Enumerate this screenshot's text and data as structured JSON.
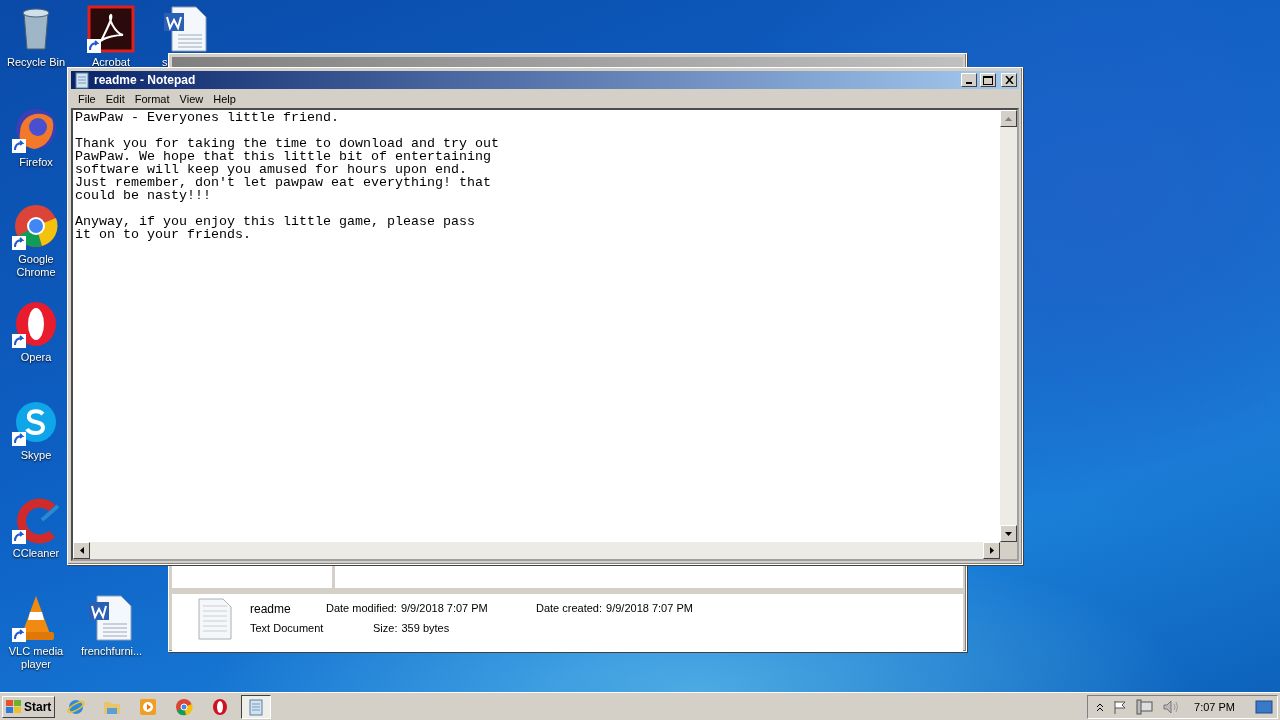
{
  "desktop_icons": [
    {
      "kind": "recycle",
      "label": "Recycle Bin",
      "shortcut": false
    },
    {
      "kind": "acrobat",
      "label": "Acrobat",
      "shortcut": true
    },
    {
      "kind": "word",
      "label": "s",
      "shortcut": false
    },
    {
      "kind": "firefox",
      "label": "Firefox",
      "shortcut": true
    },
    {
      "kind": "chrome",
      "label": "Google Chrome",
      "shortcut": true
    },
    {
      "kind": "opera",
      "label": "Opera",
      "shortcut": true
    },
    {
      "kind": "skype",
      "label": "Skype",
      "shortcut": true
    },
    {
      "kind": "ccleaner",
      "label": "CCleaner",
      "shortcut": true
    },
    {
      "kind": "vlc",
      "label": "VLC media player",
      "shortcut": true
    },
    {
      "kind": "word",
      "label": "frenchfurni...",
      "shortcut": false
    }
  ],
  "explorer": {
    "details": {
      "name": "readme",
      "type": "Text Document",
      "fields": [
        {
          "label": "Date modified:",
          "value": "9/9/2018 7:07 PM"
        },
        {
          "label": "Date created:",
          "value": "9/9/2018 7:07 PM"
        },
        {
          "label": "Size:",
          "value": "359 bytes"
        }
      ]
    }
  },
  "notepad": {
    "title": "readme - Notepad",
    "menu": [
      "File",
      "Edit",
      "Format",
      "View",
      "Help"
    ],
    "text": "PawPaw - Everyones little friend.\n\nThank you for taking the time to download and try out\nPawPaw. We hope that this little bit of entertaining\nsoftware will keep you amused for hours upon end.\nJust remember, don't let pawpaw eat everything! that\ncould be nasty!!!\n\nAnyway, if you enjoy this little game, please pass\nit on to your friends."
  },
  "taskbar": {
    "start": "Start",
    "buttons": [
      {
        "kind": "ie",
        "selected": false
      },
      {
        "kind": "folder",
        "selected": false
      },
      {
        "kind": "media",
        "selected": false
      },
      {
        "kind": "chrome",
        "selected": false
      },
      {
        "kind": "opera",
        "selected": false
      },
      {
        "kind": "notepad",
        "selected": true
      }
    ],
    "clock": "7:07 PM"
  }
}
